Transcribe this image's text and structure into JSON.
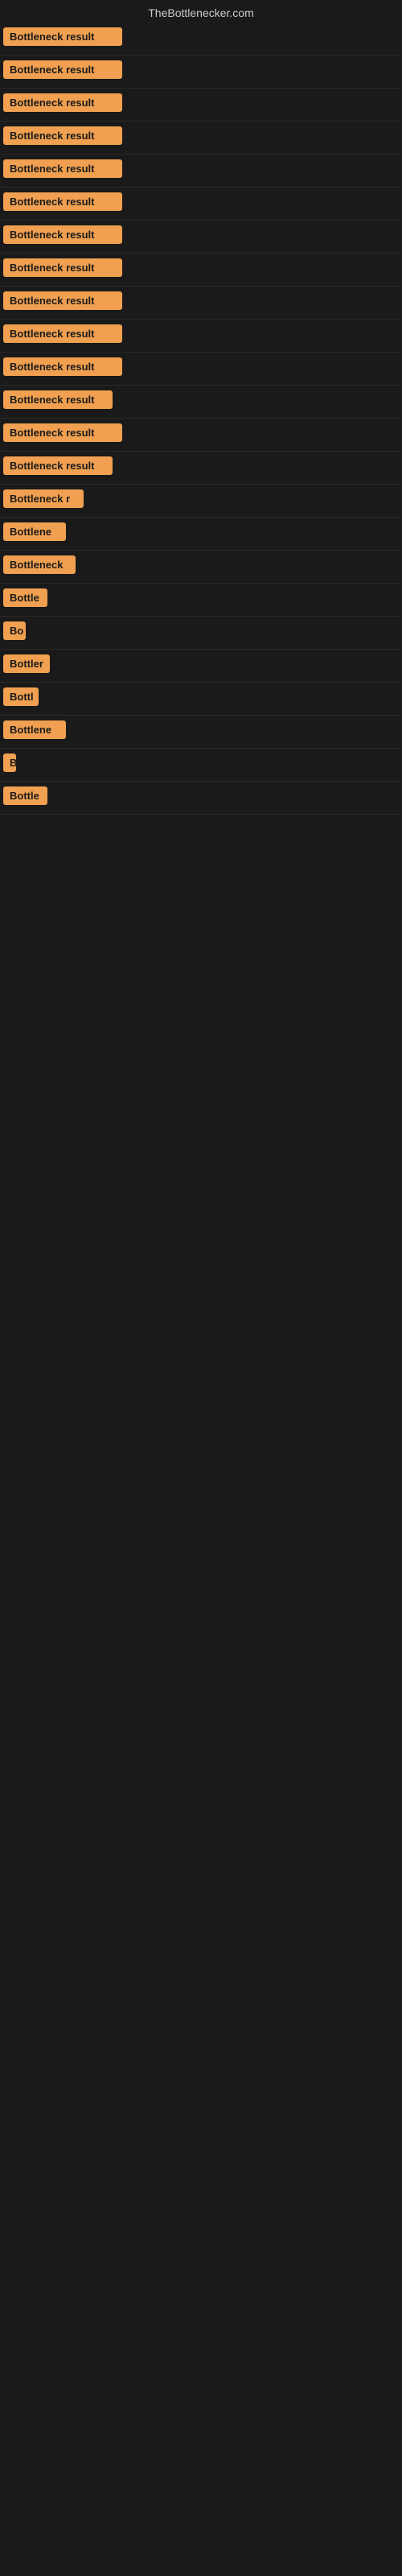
{
  "site": {
    "title": "TheBottlenecker.com"
  },
  "badges": [
    {
      "id": 1,
      "label": "Bottleneck result",
      "width": "full"
    },
    {
      "id": 2,
      "label": "Bottleneck result",
      "width": "full"
    },
    {
      "id": 3,
      "label": "Bottleneck result",
      "width": "full"
    },
    {
      "id": 4,
      "label": "Bottleneck result",
      "width": "full"
    },
    {
      "id": 5,
      "label": "Bottleneck result",
      "width": "full"
    },
    {
      "id": 6,
      "label": "Bottleneck result",
      "width": "full"
    },
    {
      "id": 7,
      "label": "Bottleneck result",
      "width": "full"
    },
    {
      "id": 8,
      "label": "Bottleneck result",
      "width": "full"
    },
    {
      "id": 9,
      "label": "Bottleneck result",
      "width": "full"
    },
    {
      "id": 10,
      "label": "Bottleneck result",
      "width": "full"
    },
    {
      "id": 11,
      "label": "Bottleneck result",
      "width": "full"
    },
    {
      "id": 12,
      "label": "Bottleneck result",
      "width": "partial-1"
    },
    {
      "id": 13,
      "label": "Bottleneck result",
      "width": "full"
    },
    {
      "id": 14,
      "label": "Bottleneck result",
      "width": "partial-1"
    },
    {
      "id": 15,
      "label": "Bottleneck r",
      "width": "partial-2"
    },
    {
      "id": 16,
      "label": "Bottlene",
      "width": "partial-3"
    },
    {
      "id": 17,
      "label": "Bottleneck",
      "width": "partial-4"
    },
    {
      "id": 18,
      "label": "Bottle",
      "width": "partial-5"
    },
    {
      "id": 19,
      "label": "Bo",
      "width": "partial-6"
    },
    {
      "id": 20,
      "label": "Bottler",
      "width": "partial-7"
    },
    {
      "id": 21,
      "label": "Bottl",
      "width": "partial-8"
    },
    {
      "id": 22,
      "label": "Bottlene",
      "width": "partial-3"
    },
    {
      "id": 23,
      "label": "B",
      "width": "partial-9"
    },
    {
      "id": 24,
      "label": "Bottle",
      "width": "partial-5"
    }
  ],
  "colors": {
    "badge_bg": "#f0a050",
    "bg": "#1a1a1a",
    "title": "#cccccc"
  }
}
